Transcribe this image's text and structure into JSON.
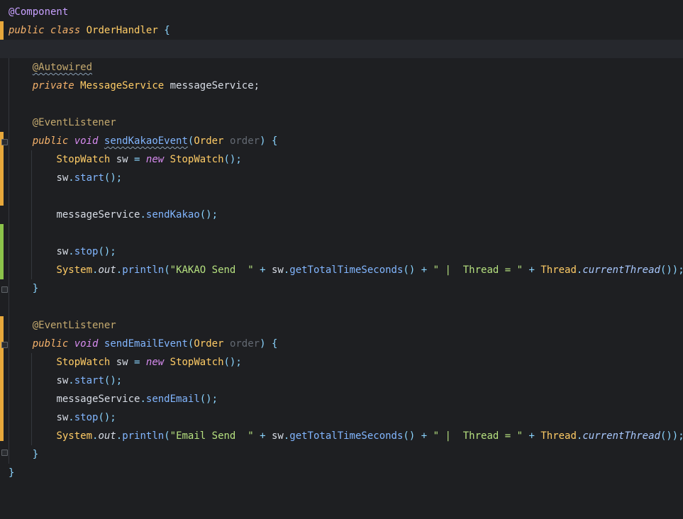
{
  "code": {
    "annotation_component": "@Component",
    "kw_public": "public",
    "kw_class": "class",
    "class_name": "OrderHandler",
    "brace_open": "{",
    "brace_close": "}",
    "annotation_autowired": "@Autowired",
    "kw_private": "private",
    "type_message_service": "MessageService",
    "field_message_service": "messageService",
    "semicolon": ";",
    "annotation_event_listener": "@EventListener",
    "kw_void": "void",
    "method_send_kakao_event": "sendKakaoEvent",
    "method_send_email_event": "sendEmailEvent",
    "type_order": "Order",
    "param_order": "order",
    "type_stopwatch": "StopWatch",
    "var_sw": "sw",
    "kw_new": "new",
    "call_start": "start",
    "call_stop": "stop",
    "call_send_kakao": "sendKakao",
    "call_send_email": "sendEmail",
    "type_system": "System",
    "field_out": "out",
    "call_println": "println",
    "str_kakao_send": "\"KAKAO Send  \"",
    "str_email_send": "\"Email Send  \"",
    "call_get_total_time_seconds": "getTotalTimeSeconds",
    "str_thread_sep": "\" |  Thread = \"",
    "type_thread": "Thread",
    "call_current_thread": "currentThread"
  }
}
